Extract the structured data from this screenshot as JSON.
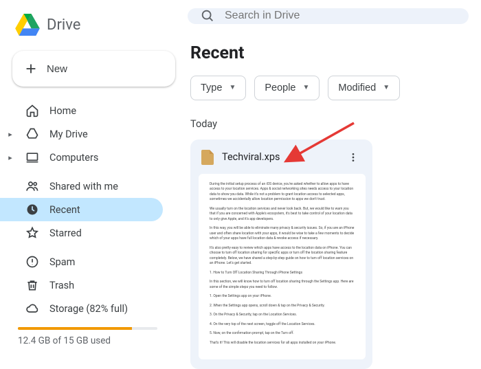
{
  "brand": {
    "label": "Drive"
  },
  "new_button": "New",
  "nav": {
    "home": "Home",
    "my_drive": "My Drive",
    "computers": "Computers",
    "shared": "Shared with me",
    "recent": "Recent",
    "starred": "Starred",
    "spam": "Spam",
    "trash": "Trash",
    "storage_label": "Storage (82% full)",
    "storage_percent": 82,
    "storage_used": "12.4 GB of 15 GB used"
  },
  "search": {
    "placeholder": "Search in Drive"
  },
  "page_title": "Recent",
  "filters": {
    "type": "Type",
    "people": "People",
    "modified": "Modified"
  },
  "section_today": "Today",
  "file": {
    "name": "Techviral.xps",
    "preview_paragraphs": [
      "During the initial setup process of an iOS device, you're asked whether to allow apps to have access to your location services. Apps & social networking sites needs access to your location data to show you data. While it's not a problem to grant location access to selected apps, sometimes we accidentally allow location permission to apps we don't trust.",
      "We usually turn on the location services and never look back. But, we would like to warn you that if you are concerned with Apple's ecosystem, it's best to take control of your location data to only give Apple, and it's app developers.",
      "In this way, you will be able to eliminate many privacy & security issues. So, if you are an iPhone user and often share location with your apps, it would be wise to take a few moments to decide which of your apps have full location data & revoke access if necessary.",
      "It's also pretty easy to review which apps have access to the location data on iPhone. You can choose to turn off location sharing for specific apps or turn off the location sharing feature completely. Below, we have shared a step-by-step guide on how to turn off location services on an iPhone. Let's get started.",
      "1. How to Turn Off Location Sharing Through iPhone Settings",
      "In this section, we will know how to turn off location sharing through the Settings app. Here are some of the simple steps you need to follow.",
      "1. Open the Settings app on your iPhone.",
      "2. When the Settings app opens, scroll down & tap on the Privacy & Security.",
      "3. On the Privacy & Security, tap on the Location Services.",
      "4. On the very top of the next screen, toggle off the Location Services.",
      "5. Now, on the confirmation prompt, tap on the Turn off.",
      "That's it! This will disable the location services for all apps installed on your iPhone."
    ]
  }
}
